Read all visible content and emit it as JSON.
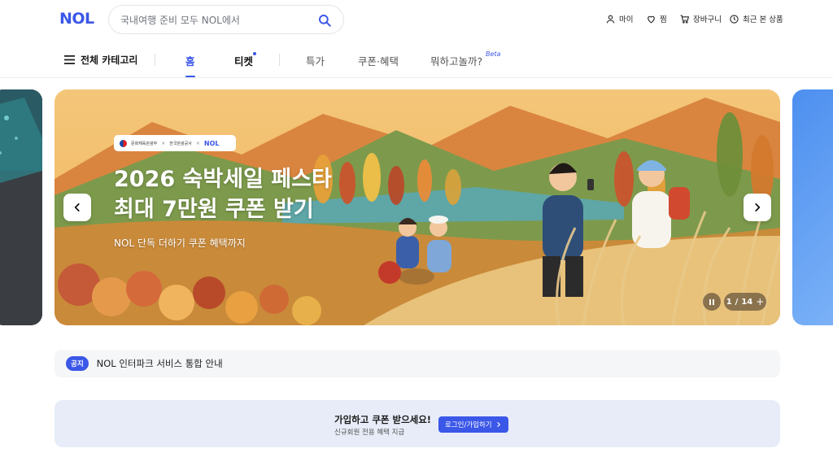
{
  "header": {
    "logo": "NOL",
    "search": {
      "placeholder": "국내여행 준비 모두 NOL에서"
    },
    "utils": [
      {
        "label": "마이",
        "icon": "user-icon"
      },
      {
        "label": "찜",
        "icon": "heart-icon"
      },
      {
        "label": "장바구니",
        "icon": "cart-icon"
      },
      {
        "label": "최근 본 상품",
        "icon": "clock-icon"
      }
    ]
  },
  "nav": {
    "category_label": "전체 카테고리",
    "tabs": [
      {
        "label": "홈",
        "state": "active"
      },
      {
        "label": "티켓"
      },
      {
        "label": "특가"
      },
      {
        "label": "쿠폰·혜택"
      },
      {
        "label": "뭐하고놀까?"
      }
    ],
    "beta_label": "Beta",
    "accent": "#3b57e8"
  },
  "banner": {
    "partner": {
      "org1": "문화체육관광부",
      "org2": "한국관광공사",
      "brand": "NOL"
    },
    "title_line1": "2026 숙박세일 페스타",
    "title_line2": "최대 7만원 쿠폰 받기",
    "subtitle": "NOL 단독 더하기 쿠폰 혜택까지",
    "pager": {
      "current": "1",
      "total": "14",
      "separator": "/"
    }
  },
  "notice": {
    "badge": "공지",
    "text": "NOL 인터파크 서비스 통합 안내"
  },
  "signup": {
    "title": "가입하고 쿠폰 받으세요!",
    "description": "신규회원 전용 혜택 지급",
    "button_label": "로그인/가입하기"
  }
}
